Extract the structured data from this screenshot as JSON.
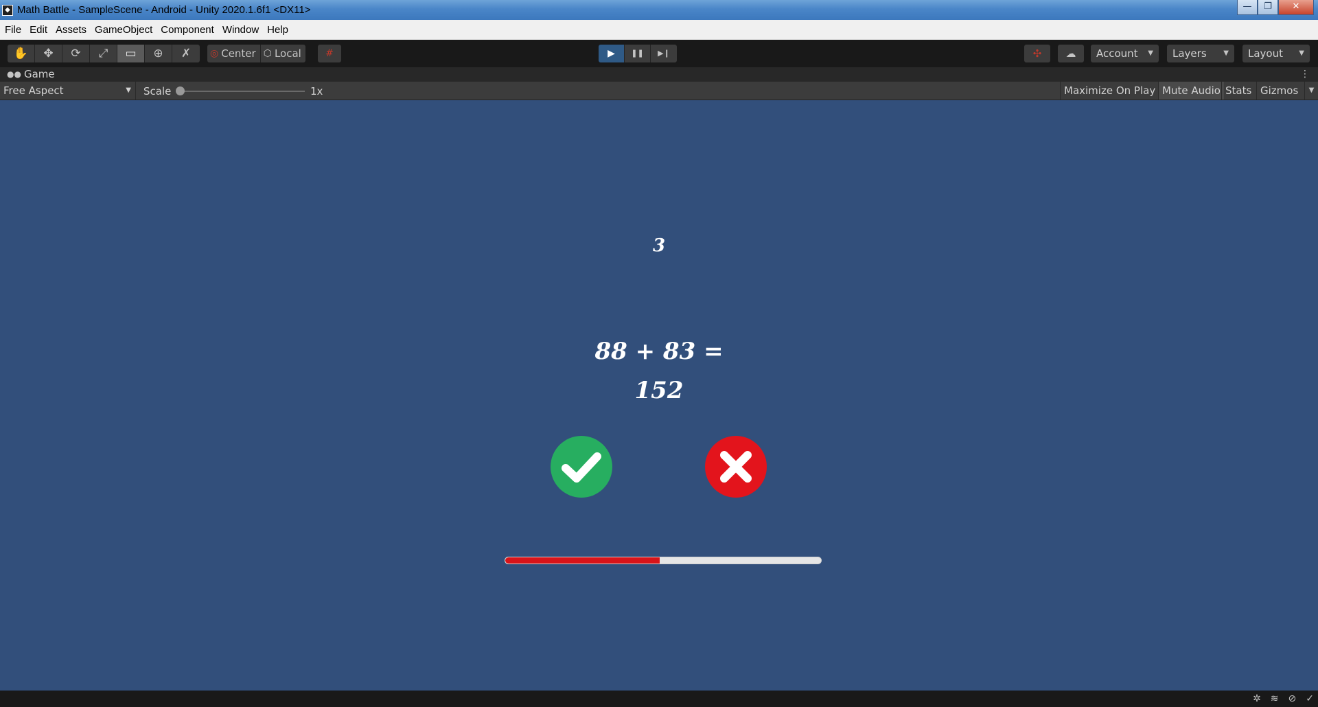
{
  "window": {
    "title": "Math Battle - SampleScene - Android - Unity 2020.1.6f1 <DX11>",
    "controls": {
      "minimize": "—",
      "maximize": "❐",
      "close": "✕"
    }
  },
  "menu": [
    "File",
    "Edit",
    "Assets",
    "GameObject",
    "Component",
    "Window",
    "Help"
  ],
  "toolbar": {
    "tools": [
      {
        "name": "hand-tool-icon",
        "glyph": "✋"
      },
      {
        "name": "move-tool-icon",
        "glyph": "✥"
      },
      {
        "name": "rotate-tool-icon",
        "glyph": "⟳"
      },
      {
        "name": "scale-tool-icon",
        "glyph": "⤢"
      },
      {
        "name": "rect-tool-icon",
        "glyph": "▭"
      },
      {
        "name": "transform-tool-icon",
        "glyph": "⊕"
      },
      {
        "name": "custom-tool-icon",
        "glyph": "✗"
      }
    ],
    "pivot": "Center",
    "space": "Local",
    "snap_icon": "#",
    "play": "▶",
    "pause": "❚❚",
    "step": "▶❙",
    "collab_icon": "☁",
    "services_icon": "✣",
    "account": "Account",
    "layers": "Layers",
    "layout": "Layout",
    "caret": "▼"
  },
  "game_tab": {
    "label": "Game",
    "icon": "🎮",
    "menu_icon": "⋮"
  },
  "game_bar": {
    "aspect": "Free Aspect",
    "scale_label": "Scale",
    "scale_value": "1x",
    "maximize_on_play": "Maximize On Play",
    "mute_audio": "Mute Audio",
    "stats": "Stats",
    "gizmos": "Gizmos"
  },
  "game": {
    "background": "#324f7b",
    "timer": "3",
    "equation": "88 + 83 =",
    "answer": "152",
    "correct_color": "#27ae60",
    "wrong_color": "#e3141c",
    "progress_fraction": 0.49,
    "progress_color": "#d8141a"
  },
  "status_bar": {
    "icons": [
      "bug-icon",
      "layers-stack-icon",
      "network-icon",
      "check-circle-icon"
    ]
  }
}
